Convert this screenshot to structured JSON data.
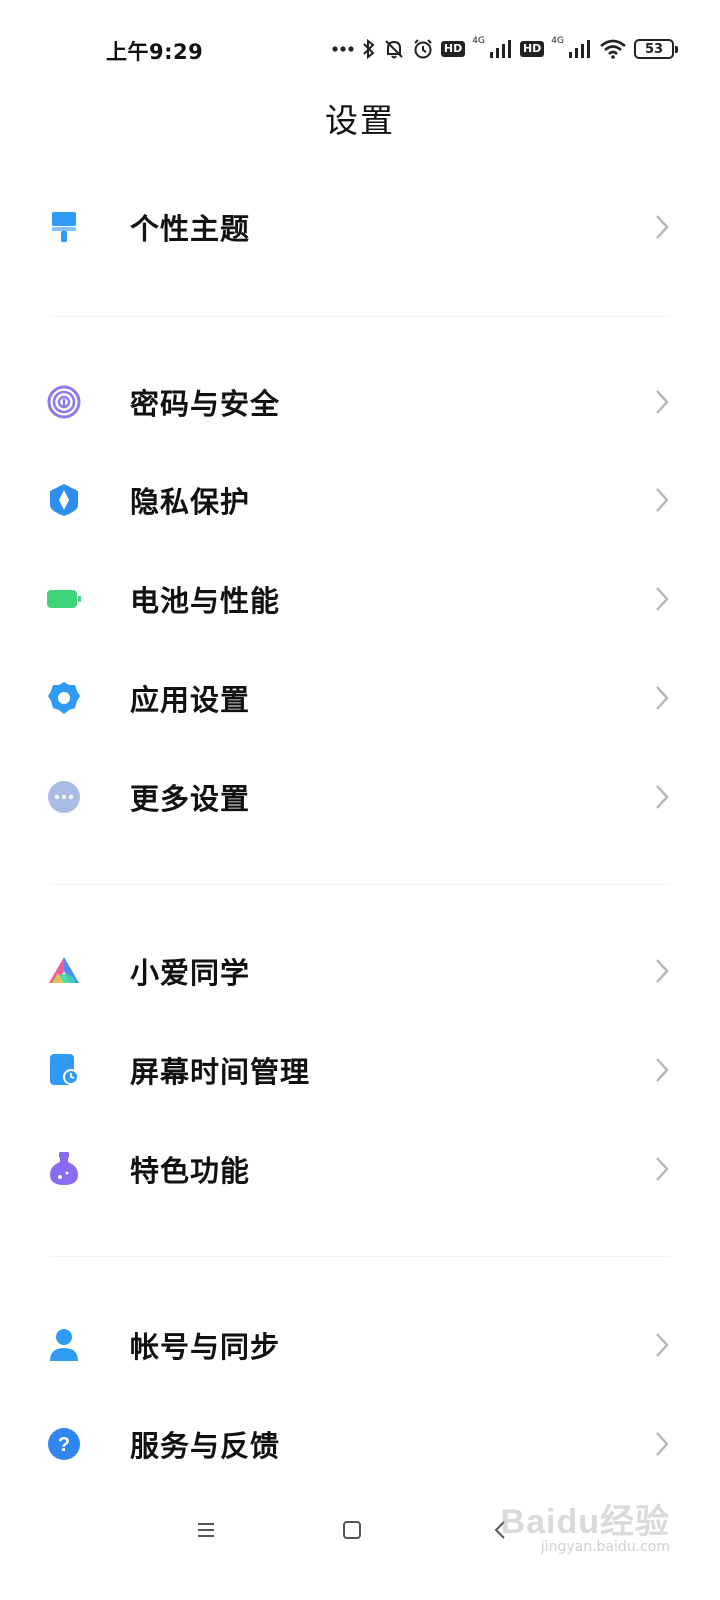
{
  "status_bar": {
    "time": "上午9:29",
    "hd_label_1": "HD",
    "network_1": "4G",
    "hd_label_2": "HD",
    "network_2": "4G",
    "battery_level": "53",
    "icons": [
      "dots-icon",
      "bluetooth-icon",
      "mute-icon",
      "alarm-icon",
      "signal-icon",
      "wifi-icon",
      "battery-icon"
    ]
  },
  "header": {
    "title": "设置"
  },
  "settings": {
    "items": [
      {
        "label": "个性主题",
        "icon": "paint-brush-icon",
        "color": "#2f9bf5"
      },
      {
        "label": "密码与安全",
        "icon": "fingerprint-icon",
        "color": "#8a7cf0"
      },
      {
        "label": "隐私保护",
        "icon": "shield-icon",
        "color": "#2f8ff0"
      },
      {
        "label": "电池与性能",
        "icon": "battery-icon",
        "color": "#3fd37a"
      },
      {
        "label": "应用设置",
        "icon": "gear-icon",
        "color": "#2f9bf5"
      },
      {
        "label": "更多设置",
        "icon": "more-dots-icon",
        "color": "#a9bce3"
      },
      {
        "label": "小爱同学",
        "icon": "xiaoai-icon",
        "color": "#4c8cf5"
      },
      {
        "label": "屏幕时间管理",
        "icon": "screen-time-icon",
        "color": "#2f9bf5"
      },
      {
        "label": "特色功能",
        "icon": "flask-icon",
        "color": "#8a6cf0"
      },
      {
        "label": "帐号与同步",
        "icon": "person-icon",
        "color": "#2f9bf5"
      },
      {
        "label": "服务与反馈",
        "icon": "help-icon",
        "color": "#2f86f0"
      }
    ]
  },
  "nav_bar": {
    "buttons": [
      "menu-icon",
      "home-icon",
      "back-icon"
    ]
  },
  "watermark": {
    "logo": "Baidu经验",
    "sub": "jingyan.baidu.com"
  }
}
